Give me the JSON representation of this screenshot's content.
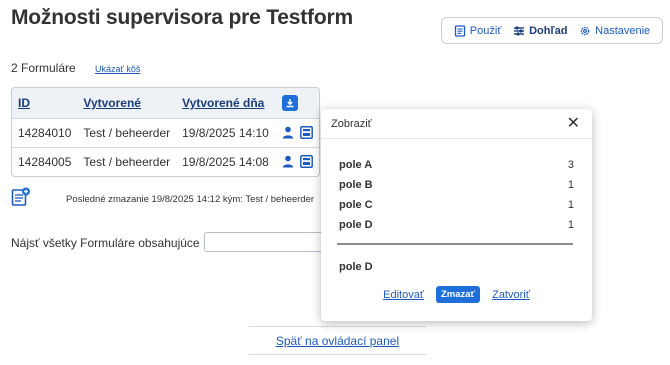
{
  "page": {
    "title": "Možnosti supervisora pre Testform"
  },
  "toolbar": {
    "use_label": "Použiť",
    "view_label": "Dohľad",
    "settings_label": "Nastavenie"
  },
  "summary": {
    "count_text": "2 Formuláre",
    "trash_link": "Ukázať kôš"
  },
  "table": {
    "headers": [
      "ID",
      "Vytvorené",
      "Vytvorené dňa"
    ],
    "rows": [
      {
        "id": "14284010",
        "created_by": "Test / beheerder",
        "created_on": "19/8/2025 14:10"
      },
      {
        "id": "14284005",
        "created_by": "Test / beheerder",
        "created_on": "19/8/2025 14:08"
      }
    ]
  },
  "last_delete": "Posledné zmazanie 19/8/2025 14:12 kým: Test / beheerder",
  "search": {
    "label": "Nájsť všetky Formuláre obsahujúce",
    "value": ""
  },
  "footer": {
    "back_link": "Späť na ovládací panel"
  },
  "popup": {
    "title": "Zobraziť",
    "fields": [
      {
        "name": "pole A",
        "count": "3"
      },
      {
        "name": "pole B",
        "count": "1"
      },
      {
        "name": "pole C",
        "count": "1"
      },
      {
        "name": "pole D",
        "count": "1"
      }
    ],
    "selected_field": "pole D",
    "edit_label": "Editovať",
    "delete_label": "Zmazať",
    "close_label": "Zatvoriť"
  },
  "colors": {
    "accent": "#1e6fd9",
    "link": "#1e5bbf",
    "header_text": "#1a3d7c"
  }
}
